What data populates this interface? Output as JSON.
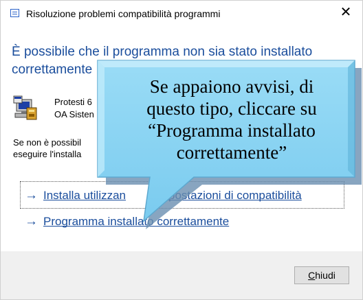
{
  "window": {
    "title": "Risoluzione problemi compatibilità programmi",
    "close_glyph": "✕"
  },
  "heading": "È possibile che il programma non sia stato installato correttamente",
  "app": {
    "name": "Protesti 6",
    "publisher": "OA Sisten",
    "icon": "setup-computer-icon"
  },
  "body_text": {
    "line1": "Se non è possibil",
    "line2": "eseguire l'installa"
  },
  "options": [
    {
      "arrow": "→",
      "label": "Installa utilizzan",
      "label_rest": "postazioni di compatibilità",
      "focused": true
    },
    {
      "arrow": "→",
      "label": "Programma installato correttamente",
      "focused": false
    }
  ],
  "footer": {
    "close_button_mnemonic": "C",
    "close_button_rest": "hiudi"
  },
  "callout": {
    "text_lines": [
      "Se appaiono avvisi, di",
      "questo tipo, cliccare su",
      "“Programma installato",
      "correttamente”"
    ],
    "fill_color": "#86d4f2",
    "shadow_color": "#6a8fb0"
  },
  "colors": {
    "heading": "#1a4d9c",
    "link": "#1a4d9c",
    "footer_bg": "#f0f0f0"
  }
}
